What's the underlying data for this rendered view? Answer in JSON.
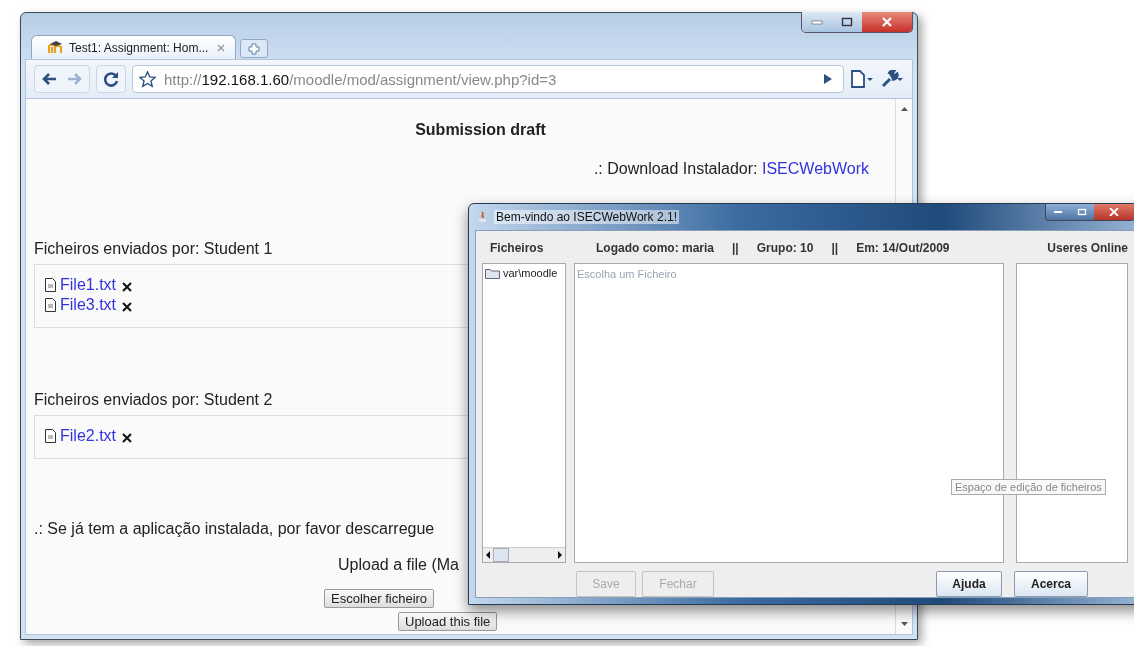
{
  "browser": {
    "tab_title": "Test1: Assignment: Hom...",
    "url": {
      "scheme": "http://",
      "host": "192.168.1.60",
      "path": "/moodle/mod/assignment/view.php?id=3"
    }
  },
  "page": {
    "heading": "Submission draft",
    "download": {
      "label": ".: Download Instalador:",
      "link": "ISECWebWork"
    },
    "submissions": [
      {
        "label": "Ficheiros enviados por: Student 1",
        "files": [
          "File1.txt",
          "File3.txt"
        ]
      },
      {
        "label": "Ficheiros enviados por: Student 2",
        "files": [
          "File2.txt"
        ]
      }
    ],
    "note": ".: Se já tem a aplicação instalada, por favor descarregue",
    "upload_label": "Upload a file (Ma",
    "choose_button": "Escolher ficheiro",
    "upload_button": "Upload this file"
  },
  "app": {
    "title": "Bem-vindo ao ISECWebWork 2.1!",
    "files_header": "Ficheiros",
    "status": [
      "Logado como: maria",
      "||",
      "Grupo: 10",
      "||",
      "Em: 14/Out/2009"
    ],
    "users_header": "Useres Online",
    "tree_item": "var\\moodle",
    "editor": {
      "placeholder": "Escolha um Ficheiro"
    },
    "tooltip": "Espaço de edição de ficheiros",
    "buttons": [
      {
        "label": "Save",
        "disabled": true
      },
      {
        "label": "Fechar",
        "disabled": true
      },
      {
        "label": "Ajuda",
        "disabled": false
      },
      {
        "label": "Acerca",
        "disabled": false
      }
    ]
  }
}
